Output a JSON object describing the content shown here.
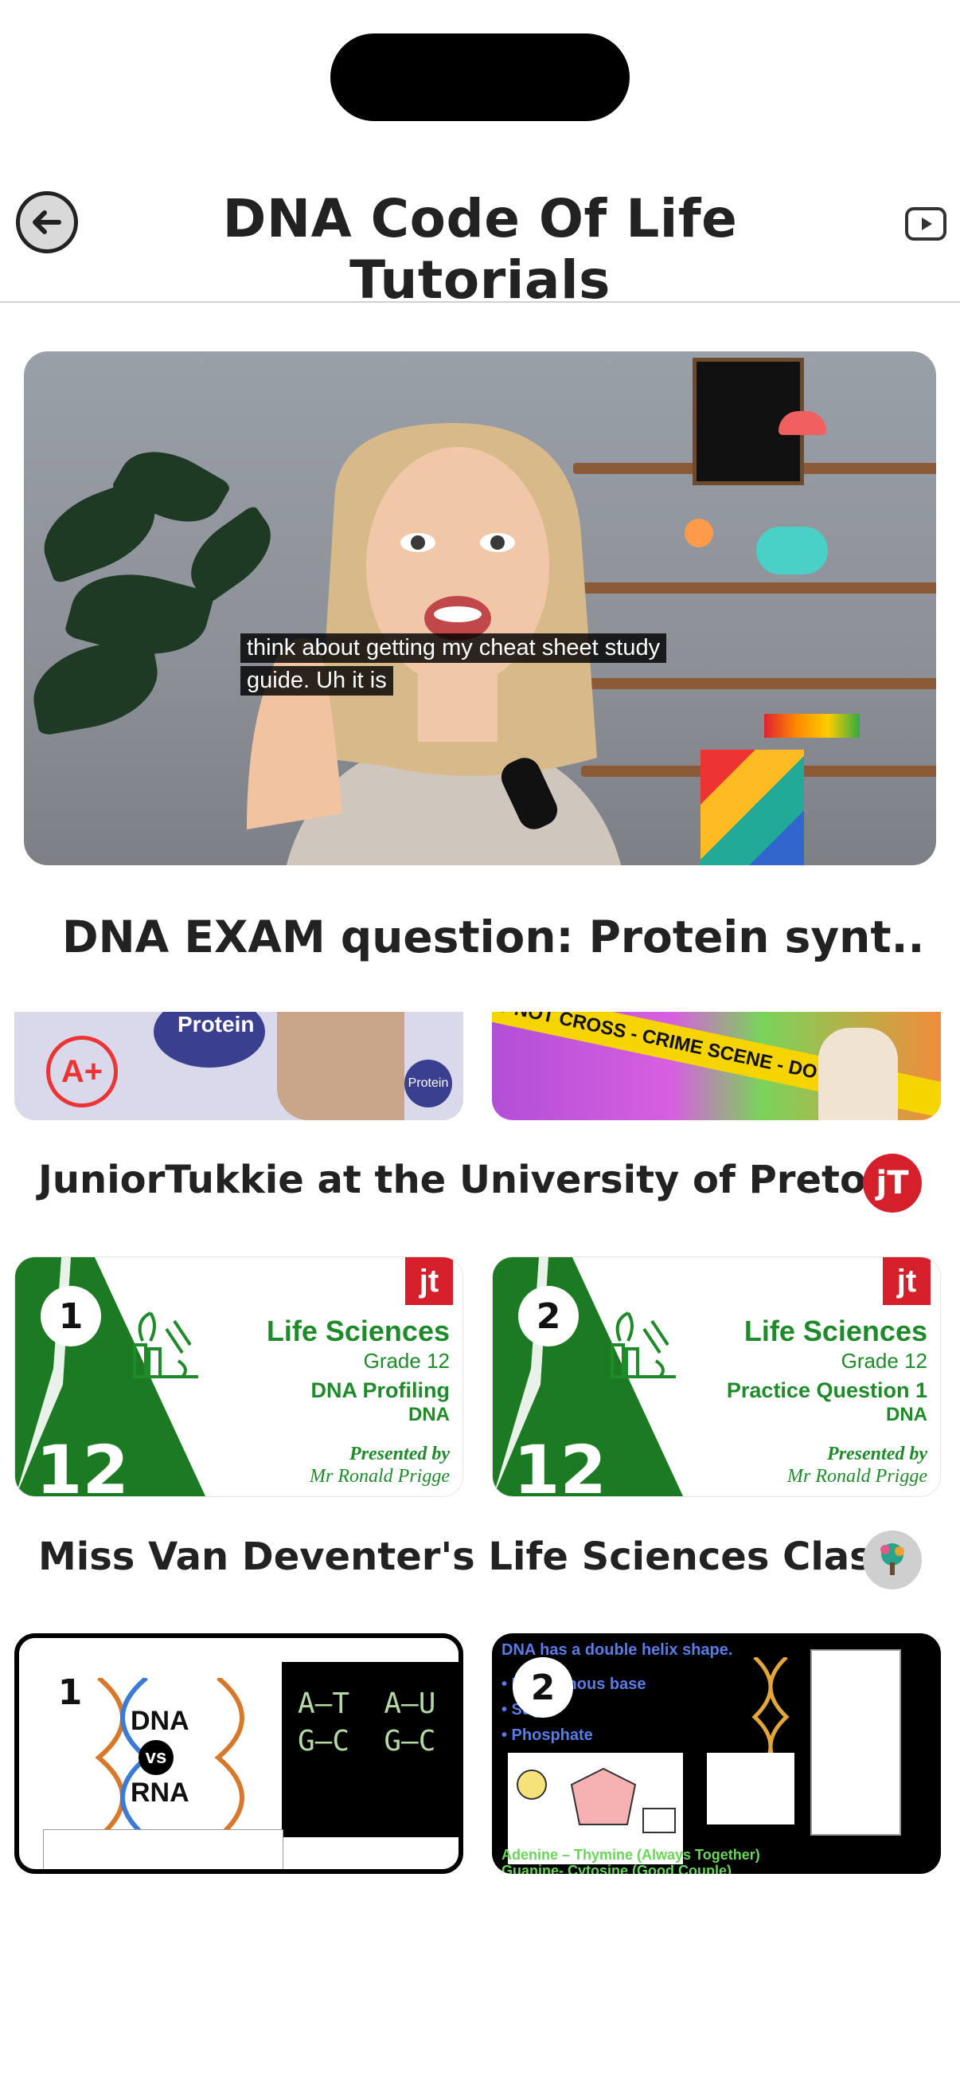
{
  "header": {
    "title": "DNA Code Of Life Tutorials",
    "back_icon": "back-arrow-icon",
    "youtube_icon": "youtube-play-icon"
  },
  "featured": {
    "caption_line1": "think about getting my cheat sheet study",
    "caption_line2": "guide. Uh it is",
    "title": "DNA EXAM question: Protein synt...",
    "thumb_left_text": "Protein",
    "thumb_left_badge": "A+",
    "thumb_left_text2": "Protein",
    "thumb_right_tape": "DO NOT CROSS - CRIME SCENE - DO NOT"
  },
  "channels": [
    {
      "name": "JuniorTukkie at the University of Pretoria",
      "avatar_text": "jT",
      "videos": [
        {
          "number": "1",
          "subject": "Life Sciences",
          "grade": "Grade 12",
          "topic": "DNA Profiling",
          "subtopic": "DNA",
          "presented_by": "Presented by",
          "presenter": "Mr Ronald Prigge",
          "big_number": "12"
        },
        {
          "number": "2",
          "subject": "Life Sciences",
          "grade": "Grade 12",
          "topic": "Practice Question 1",
          "subtopic": "DNA",
          "presented_by": "Presented by",
          "presenter": "Mr Ronald Prigge",
          "big_number": "12"
        }
      ]
    },
    {
      "name": "Miss Van Deventer's Life Sciences Class",
      "videos": [
        {
          "number": "1",
          "label_dna": "DNA",
          "label_vs": "vs",
          "label_rna": "RNA"
        },
        {
          "number": "2",
          "line1": "DNA has a double helix shape.",
          "line2": "Adenine – Thymine (Always Together)",
          "line3": "Guanine- Cytosine (Good Couple)"
        }
      ]
    }
  ],
  "colors": {
    "green": "#1f8a2a",
    "jt_red": "#d51f2a"
  }
}
